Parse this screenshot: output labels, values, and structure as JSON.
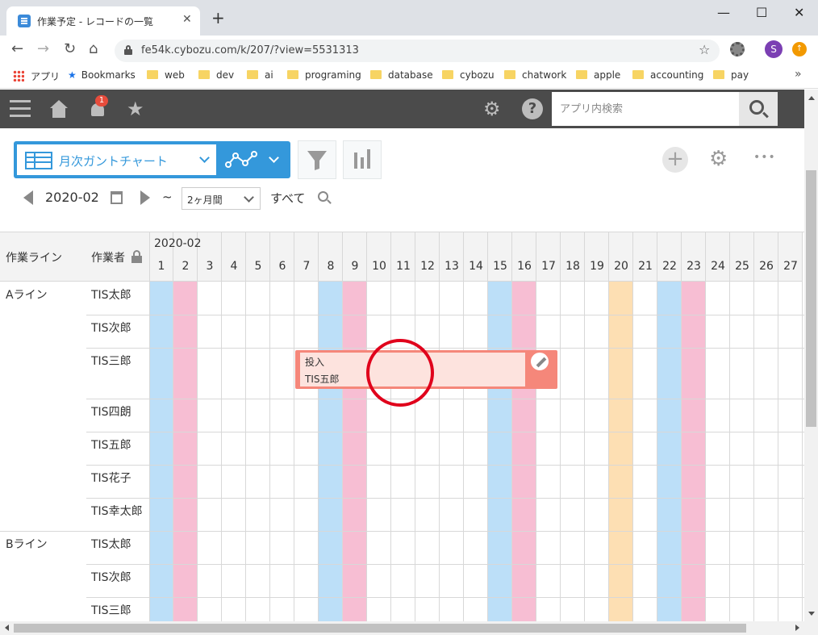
{
  "browser": {
    "tab_title": "作業予定 - レコードの一覧",
    "new_tab": "+",
    "close": "✕",
    "url": "fe54k.cybozu.com/k/207/?view=5531313",
    "avatar_letter": "S",
    "bookmarks": [
      "アプリ",
      "Bookmarks",
      "web",
      "dev",
      "ai",
      "programing",
      "database",
      "cybozu",
      "chatwork",
      "apple",
      "accounting",
      "pay"
    ],
    "more": "»"
  },
  "header": {
    "notification_count": "1",
    "search_placeholder": "アプリ内検索"
  },
  "toolbar": {
    "view_name": "月次ガントチャート",
    "add": "+",
    "more": "•••",
    "date": "2020-02",
    "tilde": "~",
    "range": "2ヶ月間",
    "all": "すべて"
  },
  "gantt": {
    "col_line": "作業ライン",
    "col_worker": "作業者",
    "month": "2020-02",
    "days": [
      "1",
      "2",
      "3",
      "4",
      "5",
      "6",
      "7",
      "8",
      "9",
      "10",
      "11",
      "12",
      "13",
      "14",
      "15",
      "16",
      "17",
      "18",
      "19",
      "20",
      "21",
      "22",
      "23",
      "24",
      "25",
      "26",
      "27"
    ],
    "lines": [
      "Aライン",
      "Bライン"
    ],
    "workers": [
      "TIS太郎",
      "TIS次郎",
      "TIS三郎",
      "TIS四朗",
      "TIS五郎",
      "TIS花子",
      "TIS幸太郎",
      "TIS太郎",
      "TIS次郎",
      "TIS三郎"
    ],
    "task": {
      "title": "投入",
      "worker": "TIS五郎"
    }
  },
  "colors": {
    "accent": "#3498db",
    "saturday": "#bcdff8",
    "sunday": "#f7bed3",
    "holiday": "#fddfb3",
    "bar": "#f5877a",
    "mark": "#e0001b"
  }
}
